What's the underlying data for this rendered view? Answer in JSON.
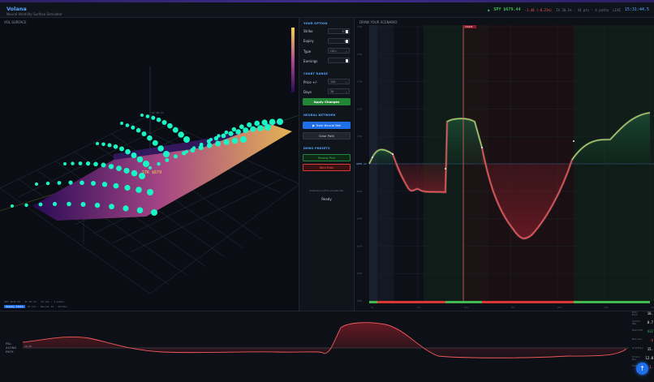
{
  "app": {
    "title": "Volana",
    "subtitle": "Neural Volatility Surface Simulator"
  },
  "ticker": {
    "symbol": "SPY $679.44",
    "change": "-1.46 (-0.21%)",
    "meta": "IV 20.1% · 44 pts · 4 paths",
    "status": "LIVE",
    "clock": "15:31:44.5"
  },
  "vol_surface": {
    "title": "VOL SURFACE",
    "spot_label": "STK $679",
    "info": "SPY $679.44 · IV 20.1% · 44 pts · 4 paths",
    "mode_badge": "Steady State",
    "footer": "45 pts · Neural AI · Rotate",
    "colorbar_from": "#2a0a59",
    "colorbar_to": "#f7d24a",
    "point_color": "#19f5c4"
  },
  "option": {
    "section": "YOUR OPTION",
    "strike_label": "Strike",
    "strike_value": "679",
    "expiry_label": "Expiry",
    "expiry_value": "30",
    "type_label": "Type",
    "type_value": "CALL",
    "earnings_label": "Earnings",
    "earnings_value": "0"
  },
  "chart_range": {
    "section": "CHART RANGE",
    "price_label": "Price +/-",
    "price_value": "150",
    "days_label": "Days",
    "days_value": "30",
    "apply_label": "Apply Changes"
  },
  "neural": {
    "section": "NEURAL NETWORK",
    "train_label": "▶ Train Neural Net",
    "clear_label": "Clear Path"
  },
  "demo": {
    "section": "DEMO PRESETS",
    "steady_label": "Steady Run",
    "wild_label": "Wild Ride",
    "caption": "Generate a path to simulate P&L",
    "status": "Ready"
  },
  "draw": {
    "title": "DRAW YOUR SCENARIO",
    "strike_tag": "STRIKE",
    "spot_tag": "$679.44",
    "y_ticks": [
      "$790",
      "$760",
      "$740",
      "$720",
      "$700",
      "$680",
      "$660",
      "$640",
      "$620",
      "$600",
      "$580"
    ],
    "x_ticks": [
      "1d",
      "5d",
      "10d",
      "15d",
      "20d",
      "25d",
      "30d"
    ]
  },
  "bottom": {
    "pnl_label": "P&L ALONG PATH",
    "zero_tag": "$0.00",
    "stats": [
      {
        "k": "Entry Price",
        "v": "16."
      },
      {
        "k": "Current P&L",
        "v": "0.7"
      },
      {
        "k": "Max Profit",
        "v": "$32"
      },
      {
        "k": "Max Loss",
        "v": "-$"
      },
      {
        "k": "IV at Entry",
        "v": "15."
      },
      {
        "k": "Time to Exp",
        "v": "12.0"
      },
      {
        "k": "Theta /day",
        "v": "-1."
      }
    ],
    "fab_icon": "↑"
  }
}
